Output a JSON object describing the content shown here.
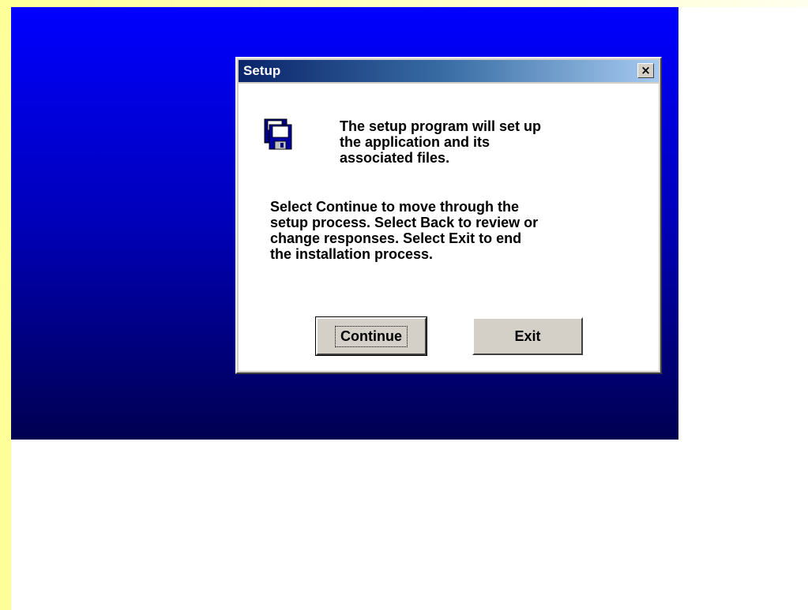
{
  "dialog": {
    "title": "Setup",
    "close_glyph": "×",
    "icon": "floppy-disk-icon",
    "intro": "The setup program will set up\nthe application and its\nassociated files.",
    "instructions": "Select Continue to move through the\nsetup process. Select Back to review or\nchange responses. Select Exit to end\nthe installation process.",
    "buttons": {
      "continue_label": "Continue",
      "exit_label": "Exit"
    }
  },
  "colors": {
    "page_strip": "#ffff99",
    "setup_background_top": "#0000ff",
    "setup_background_bottom": "#000050",
    "title_bar_start": "#0a246a",
    "title_bar_end": "#a6caf0",
    "button_face": "#d4d0c8"
  }
}
